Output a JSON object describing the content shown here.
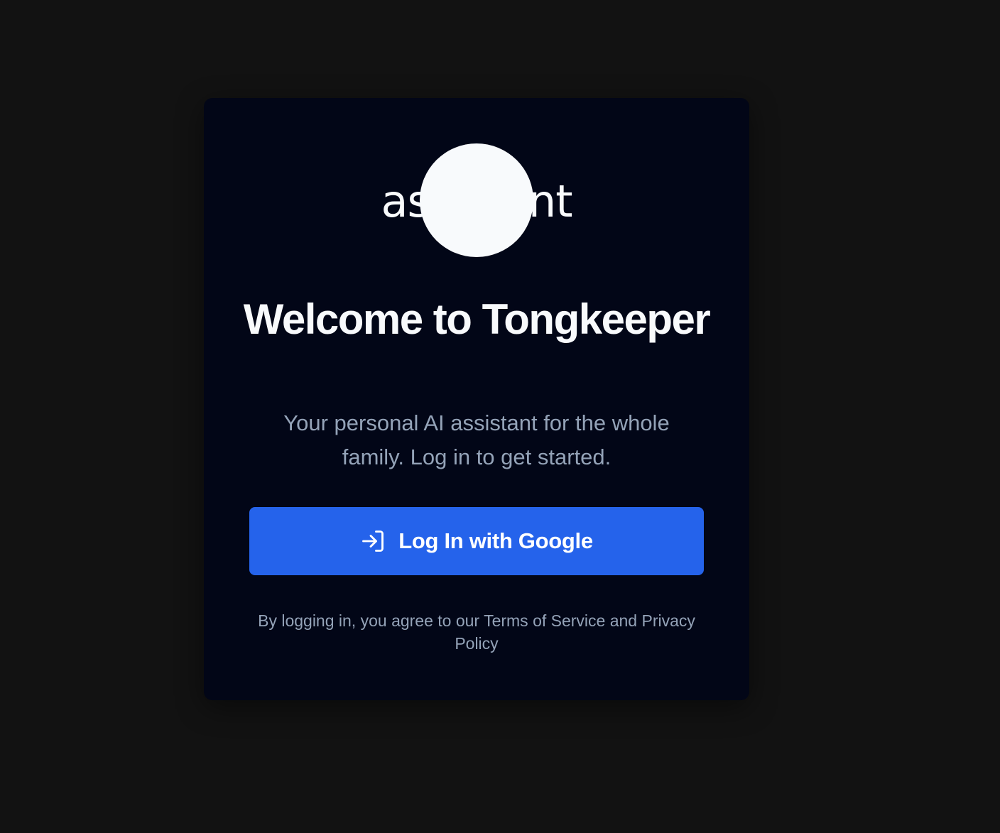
{
  "logo": {
    "alt_text": "assistant"
  },
  "card": {
    "title": "Welcome to Tongkeeper",
    "subtitle": "Your personal AI assistant for the whole family. Log in to get started.",
    "login_button": {
      "label": "Log In with Google",
      "icon": "log-in-icon"
    },
    "legal": "By logging in, you agree to our Terms of Service and Privacy Policy"
  },
  "colors": {
    "page_background": "#121212",
    "card_background": "#020617",
    "button_accent": "#2563eb",
    "text_primary": "#f8fafc",
    "text_muted": "#94a3b8"
  }
}
